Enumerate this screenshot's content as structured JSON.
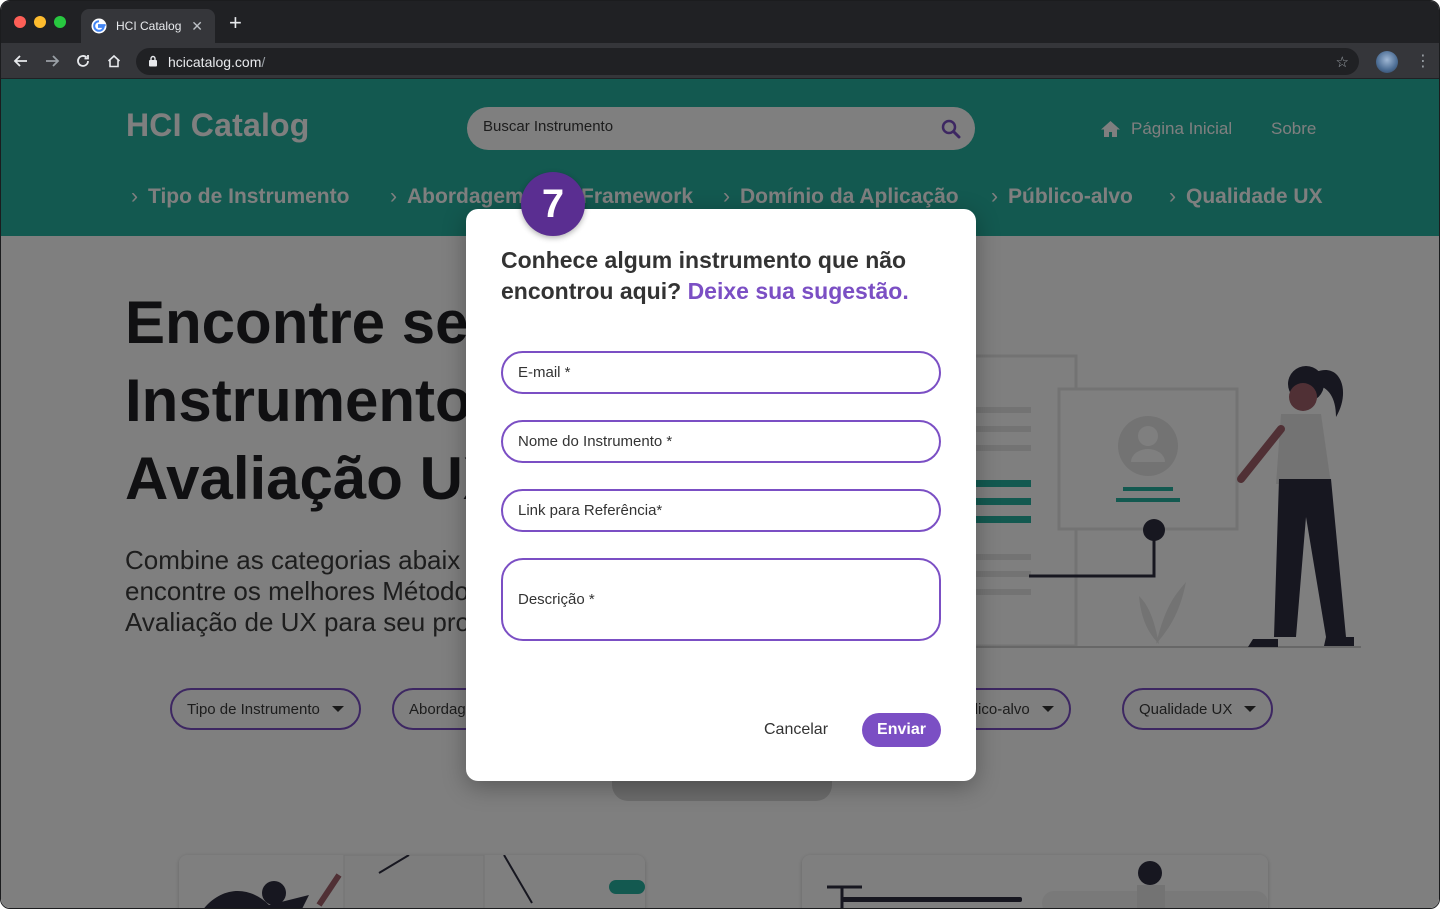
{
  "browser": {
    "tab_title": "HCI Catalog",
    "tab_close": "✕",
    "new_tab": "+",
    "url_host": "hcicatalog.com",
    "url_path": "/"
  },
  "header": {
    "logo": "HCI Catalog",
    "search_placeholder": "Buscar Instrumento",
    "links": {
      "home": "Página Inicial",
      "about": "Sobre"
    }
  },
  "category_nav": [
    "Tipo de Instrumento",
    "Abordagem",
    "Framework",
    "Domínio da Aplicação",
    "Público-alvo",
    "Qualidade UX"
  ],
  "hero": {
    "title_lines": [
      "Encontre se",
      "Instrumento",
      "Avaliação UX"
    ],
    "subtitle_lines": [
      "Combine as categorias abaix",
      "encontre os melhores Método",
      "Avaliação de UX para seu pro"
    ]
  },
  "filters": [
    "Tipo de Instrumento",
    "Abordag",
    "Público-alvo",
    "Qualidade UX"
  ],
  "modal": {
    "title_plain": "Conhece algum instrumento que não encontrou aqui?",
    "title_accent": "Deixe sua sugestão.",
    "fields": {
      "email": "E-mail *",
      "name": "Nome do Instrumento *",
      "link": "Link para Referência*",
      "description": "Descrição *"
    },
    "cancel": "Cancelar",
    "submit": "Enviar"
  },
  "step_badge": "7",
  "colors": {
    "teal": "#26b2a0",
    "purple": "#7b4fc4",
    "badge": "#5a2e91"
  }
}
